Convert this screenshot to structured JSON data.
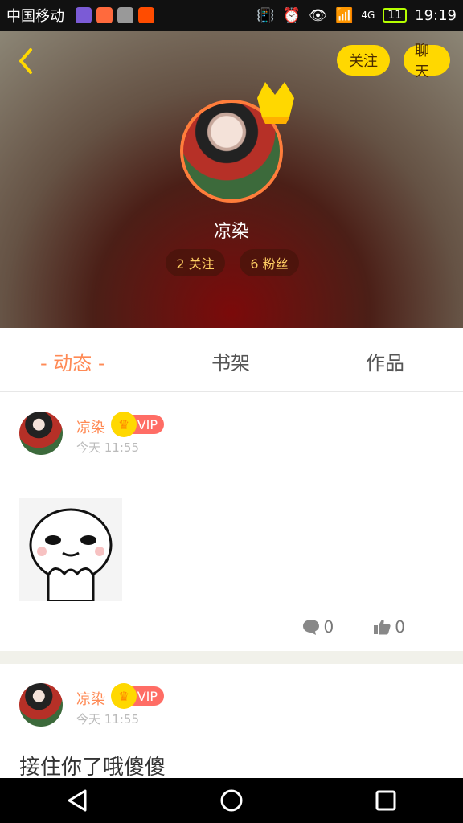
{
  "status_bar": {
    "carrier": "中国移动",
    "network": "4G",
    "battery": "11",
    "time": "19:19"
  },
  "profile": {
    "follow_label": "关注",
    "chat_label": "聊天",
    "name": "凉染",
    "following": "2 关注",
    "followers": "6 粉丝"
  },
  "tabs": [
    {
      "label": "动态",
      "active": true
    },
    {
      "label": "书架"
    },
    {
      "label": "作品"
    }
  ],
  "posts": [
    {
      "user": "凉染",
      "vip": "VIP",
      "time": "今天 11:55",
      "comments": "0",
      "likes": "0"
    },
    {
      "user": "凉染",
      "vip": "VIP",
      "time": "今天 11:55",
      "text": "接住你了哦傻傻"
    }
  ],
  "colors": {
    "accent": "#ff8a55",
    "button_yellow": "#ffd800",
    "vip_red": "#ff6d65"
  }
}
